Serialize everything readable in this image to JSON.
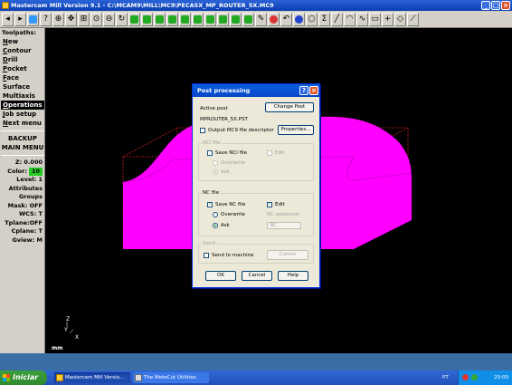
{
  "window": {
    "title": "Mastercam Mill Version 9.1 - C:\\MCAM9\\MILL\\MC9\\PECA5X_MP_ROUTER_5X.MC9"
  },
  "toolbar": {
    "icons": [
      "left-arrow",
      "right-arrow",
      "select",
      "help",
      "zoom",
      "pan",
      "fit",
      "zoom-window",
      "zoom-out",
      "rotate",
      "view-top",
      "view-front",
      "view-side",
      "view-iso",
      "shade",
      "mirror",
      "rotate-part",
      "translate",
      "verify",
      "backplot",
      "delete",
      "undo",
      "sphere",
      "circle",
      "sum",
      "line",
      "arc",
      "curve",
      "rectangle",
      "plus",
      "fillet",
      "chamfer"
    ]
  },
  "sidebar": {
    "heading": "Toolpaths:",
    "items": [
      {
        "label": "New",
        "hot": "N",
        "rest": "ew"
      },
      {
        "label": "Contour",
        "hot": "C",
        "rest": "ontour"
      },
      {
        "label": "Drill",
        "hot": "D",
        "rest": "rill"
      },
      {
        "label": "Pocket",
        "hot": "P",
        "rest": "ocket"
      },
      {
        "label": "Face",
        "hot": "F",
        "rest": "ace"
      },
      {
        "label": "Surface",
        "hot": "",
        "rest": "Surface"
      },
      {
        "label": "Multiaxis",
        "hot": "",
        "rest": "Multiaxis"
      },
      {
        "label": "Operations",
        "hot": "O",
        "rest": "perations"
      },
      {
        "label": "Job setup",
        "hot": "J",
        "rest": "ob setup"
      },
      {
        "label": "Next menu",
        "hot": "N",
        "rest": "ext menu"
      }
    ],
    "backup": "BACKUP",
    "main_menu": "MAIN MENU",
    "status": {
      "z": "Z:  0.000",
      "color_label": "Color:",
      "color_value": "10",
      "level": "Level:  1",
      "attributes": "Attributes",
      "groups": "Groups",
      "mask": "Mask:  OFF",
      "wcs": "WCS:  T",
      "tplane": "Tplane:OFF",
      "cplane": "Cplane:  T",
      "gview": "Gview:  M"
    }
  },
  "graphics": {
    "axis_z": "Z",
    "axis_y": "Y",
    "axis_x": "X",
    "units": "mm"
  },
  "dialog": {
    "title": "Post processing",
    "active_post_label": "Active post",
    "change_post": "Change Post",
    "post_name": "MPROUTER_5X.PST",
    "output_mc9_label": "Output MC9 file descriptor",
    "properties": "Properties...",
    "nci_group": {
      "label": "NCI file",
      "save_label": "Save NCI file",
      "edit_label": "Edit",
      "overwrite_label": "Overwrite",
      "ask_label": "Ask"
    },
    "nc_group": {
      "label": "NC file",
      "save_label": "Save NC file",
      "edit_label": "Edit",
      "overwrite_label": "Overwrite",
      "ask_label": "Ask",
      "ext_label": "NC extension",
      "ext_value": ".NC"
    },
    "send_group": {
      "label": "Send",
      "send_label": "Send to machine",
      "comm_button": "Comm"
    },
    "ok": "OK",
    "cancel": "Cancel",
    "help": "Help"
  },
  "taskbar": {
    "start": "Iniciar",
    "tasks": [
      "Mastercam Mill Versio...",
      "The MeteCut Utilities"
    ],
    "language": "PT",
    "clock": "20:00"
  },
  "colors": {
    "part": "#ff00ff",
    "boundary": "#cc2222",
    "accent": "#0a5ee0"
  }
}
